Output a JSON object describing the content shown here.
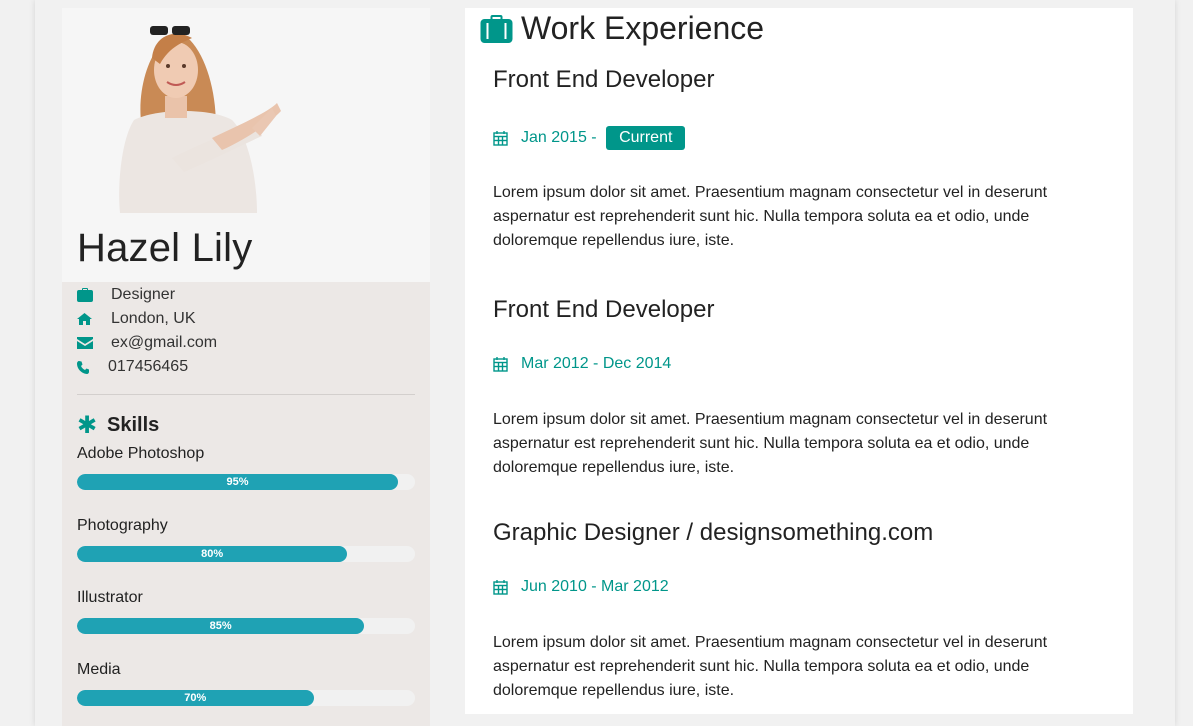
{
  "profile": {
    "name": "Hazel Lily",
    "job": "Designer",
    "location": "London, UK",
    "email": "ex@gmail.com",
    "phone": "017456465"
  },
  "skills": {
    "heading": "Skills",
    "items": [
      {
        "label": "Adobe Photoshop",
        "percent_text": "95%",
        "percent": 95
      },
      {
        "label": "Photography",
        "percent_text": "80%",
        "percent": 80
      },
      {
        "label": "Illustrator",
        "percent_text": "85%",
        "percent": 85
      },
      {
        "label": "Media",
        "percent_text": "70%",
        "percent": 70
      }
    ]
  },
  "experience": {
    "heading": "Work Experience",
    "jobs": [
      {
        "title": "Front End Developer",
        "date": "Jan 2015 - ",
        "tag": "Current",
        "desc": "Lorem ipsum dolor sit amet. Praesentium magnam consectetur vel in deserunt aspernatur est reprehenderit sunt hic. Nulla tempora soluta ea et odio, unde doloremque repellendus iure, iste."
      },
      {
        "title": "Front End Developer",
        "date": "Mar 2012 - Dec 2014",
        "desc": "Lorem ipsum dolor sit amet. Praesentium magnam consectetur vel in deserunt aspernatur est reprehenderit sunt hic. Nulla tempora soluta ea et odio, unde doloremque repellendus iure, iste."
      },
      {
        "title": "Graphic Designer / designsomething.com",
        "date": "Jun 2010 - Mar 2012",
        "desc": "Lorem ipsum dolor sit amet. Praesentium magnam consectetur vel in deserunt aspernatur est reprehenderit sunt hic. Nulla tempora soluta ea et odio, unde doloremque repellendus iure, iste."
      }
    ]
  },
  "colors": {
    "accent": "#00968a",
    "bar": "#1fa2b4",
    "sidebar_bg": "#ece8e6"
  },
  "icons": [
    "briefcase-icon",
    "home-icon",
    "envelope-icon",
    "phone-icon",
    "asterisk-icon",
    "calendar-icon"
  ]
}
